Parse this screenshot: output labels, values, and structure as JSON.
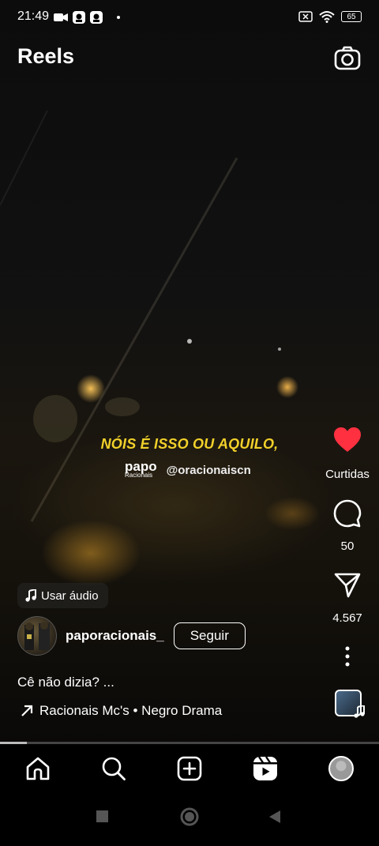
{
  "status_bar": {
    "time": "21:49",
    "battery": "65"
  },
  "header": {
    "title": "Reels"
  },
  "reel": {
    "overlay_text": "NÓIS É ISSO OU AQUILO,",
    "watermark_logo": "papo",
    "watermark_logo_sub": "Racionais",
    "watermark_handle": "@oracionaiscn",
    "use_audio_label": "Usar áudio",
    "author": "paporacionais_",
    "follow_label": "Seguir",
    "caption": "Cê não dizia? ...",
    "music": "Racionais Mc's • Negro Drama",
    "progress_fraction": 0.07
  },
  "actions": {
    "like_label": "Curtidas",
    "comments_count": "50",
    "shares_count": "4.567"
  },
  "colors": {
    "like": "#ff3040",
    "overlay_text": "#f2d12a"
  },
  "icons": {
    "status": [
      "video-camera-icon",
      "notification-icon",
      "notification-icon",
      "dot-icon",
      "sim-icon",
      "wifi-icon",
      "battery-icon"
    ],
    "nav": [
      "home-icon",
      "search-icon",
      "create-icon",
      "reels-icon",
      "profile-avatar"
    ],
    "system": [
      "recents-button",
      "home-button",
      "back-button"
    ]
  }
}
